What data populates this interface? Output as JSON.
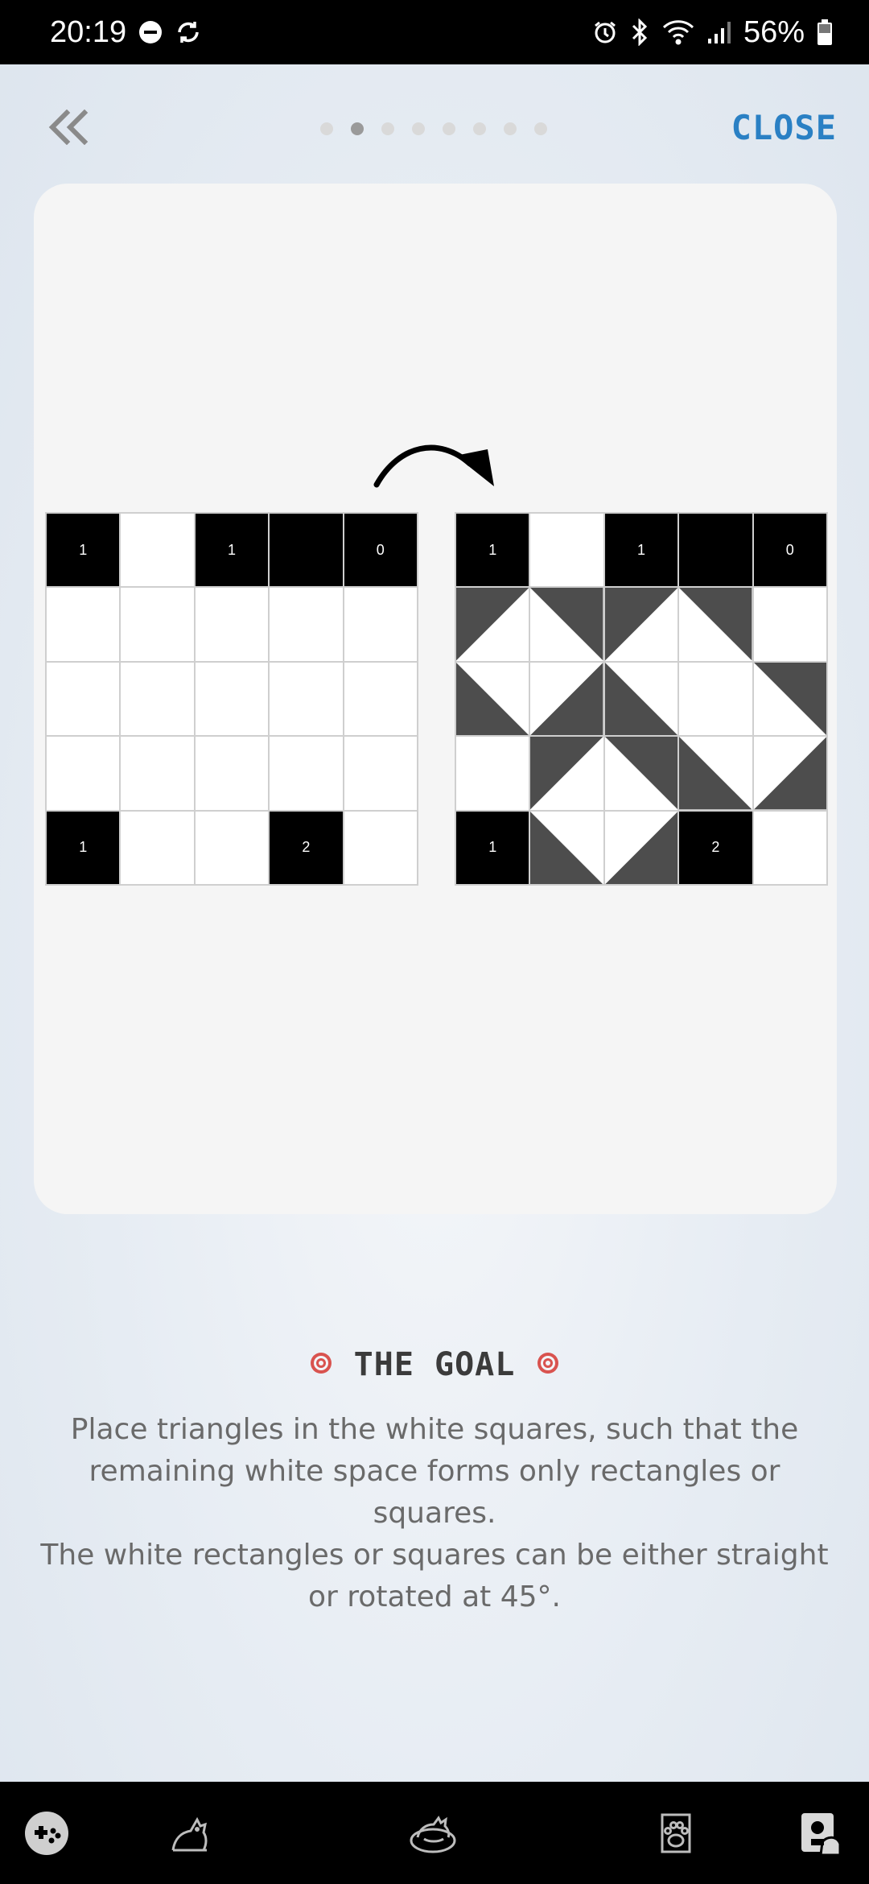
{
  "status_bar": {
    "time": "20:19",
    "battery": "56%",
    "icons": [
      "do-not-disturb-icon",
      "sync-icon",
      "alarm-icon",
      "bluetooth-icon",
      "wifi-icon",
      "signal-icon",
      "battery-icon"
    ]
  },
  "nav": {
    "back_icon": "double-chevron-left-icon",
    "close_label": "CLOSE",
    "page_count": 8,
    "current_page": 2
  },
  "illustration": {
    "arrow_icon": "curved-arrow-icon",
    "left_grid": {
      "numbers": {
        "r0c0": "1",
        "r0c2": "1",
        "r0c4": "0",
        "r4c0": "1",
        "r4c3": "2"
      }
    },
    "right_grid": {
      "numbers": {
        "r0c0": "1",
        "r0c2": "1",
        "r0c4": "0",
        "r4c0": "1",
        "r4c3": "2"
      }
    }
  },
  "goal": {
    "title": "THE GOAL",
    "icon": "target-icon",
    "line1": "Place triangles in the white squares, such that the remaining white space forms only rectangles or squares.",
    "line2": "The white rectangles or squares can be either straight or rotated at 45°."
  },
  "bottom_nav": {
    "items": [
      "gamepad-icon",
      "cat-stretch-icon",
      "cat-bed-icon",
      "paw-icon",
      "cat-profile-icon"
    ]
  },
  "colors": {
    "accent": "#2a80c4",
    "triangle": "#4d4d4d",
    "target": "#d9534f"
  }
}
